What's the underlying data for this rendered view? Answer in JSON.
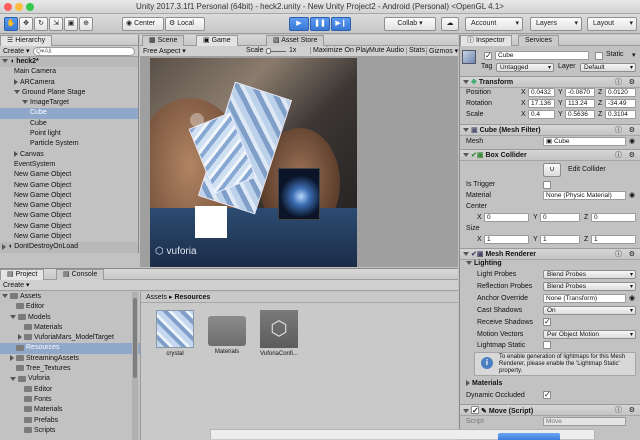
{
  "window": {
    "title": "Unity 2017.3.1f1 Personal (64bit) - heck2.unity - New Unity Project2 - Android (Personal) <OpenGL 4.1>"
  },
  "toolbar": {
    "pivot": "Center",
    "space": "Local",
    "collab": "Collab ▾",
    "account": "Account",
    "layers": "Layers",
    "layout": "Layout"
  },
  "hierarchy": {
    "tab": "Hierarchy",
    "create": "Create",
    "search_placeholder": "Q▾All",
    "scene": "heck2*",
    "items": [
      {
        "label": "Main Camera",
        "indent": 1,
        "fold": "",
        "selected": false
      },
      {
        "label": "ARCamera",
        "indent": 1,
        "fold": "right",
        "selected": false
      },
      {
        "label": "Ground Plane Stage",
        "indent": 1,
        "fold": "down",
        "selected": false
      },
      {
        "label": "ImageTarget",
        "indent": 2,
        "fold": "down",
        "selected": false
      },
      {
        "label": "Cube",
        "indent": 3,
        "fold": "",
        "selected": true
      },
      {
        "label": "Cube",
        "indent": 3,
        "fold": "",
        "selected": false
      },
      {
        "label": "Point light",
        "indent": 3,
        "fold": "",
        "selected": false
      },
      {
        "label": "Particle System",
        "indent": 3,
        "fold": "",
        "selected": false
      },
      {
        "label": "Canvas",
        "indent": 1,
        "fold": "right",
        "selected": false
      },
      {
        "label": "EventSystem",
        "indent": 1,
        "fold": "",
        "selected": false
      },
      {
        "label": "New Game Object",
        "indent": 1,
        "fold": "",
        "selected": false
      },
      {
        "label": "New Game Object",
        "indent": 1,
        "fold": "",
        "selected": false
      },
      {
        "label": "New Game Object",
        "indent": 1,
        "fold": "",
        "selected": false
      },
      {
        "label": "New Game Object",
        "indent": 1,
        "fold": "",
        "selected": false
      },
      {
        "label": "New Game Object",
        "indent": 1,
        "fold": "",
        "selected": false
      },
      {
        "label": "New Game Object",
        "indent": 1,
        "fold": "",
        "selected": false
      },
      {
        "label": "New Game Object",
        "indent": 1,
        "fold": "",
        "selected": false
      }
    ],
    "dontdestroy": "DontDestroyOnLoad"
  },
  "scene_tabs": {
    "scene": "Scene",
    "game": "Game",
    "asset_store": "Asset Store",
    "aspect": "Free Aspect",
    "scale_label": "Scale",
    "scale_value": "1x",
    "maximize": "Maximize On Play",
    "mute": "Mute Audio",
    "stats": "Stats",
    "gizmos": "Gizmos ▾"
  },
  "game_view": {
    "watermark": "vuforia"
  },
  "project": {
    "tab": "Project",
    "console_tab": "Console",
    "create": "Create",
    "breadcrumb_root": "Assets",
    "breadcrumb_sep": "▸",
    "breadcrumb_current": "Resources",
    "tree": [
      {
        "label": "Assets",
        "indent": 0,
        "fold": "down",
        "selected": false
      },
      {
        "label": "Editor",
        "indent": 1,
        "fold": "",
        "selected": false
      },
      {
        "label": "Models",
        "indent": 1,
        "fold": "down",
        "selected": false
      },
      {
        "label": "Materials",
        "indent": 2,
        "fold": "",
        "selected": false
      },
      {
        "label": "VuforiaMars_ModelTarget",
        "indent": 2,
        "fold": "right",
        "selected": false
      },
      {
        "label": "Resources",
        "indent": 1,
        "fold": "",
        "selected": true
      },
      {
        "label": "StreamingAssets",
        "indent": 1,
        "fold": "right",
        "selected": false
      },
      {
        "label": "Tree_Textures",
        "indent": 1,
        "fold": "",
        "selected": false
      },
      {
        "label": "Vuforia",
        "indent": 1,
        "fold": "down",
        "selected": false
      },
      {
        "label": "Editor",
        "indent": 2,
        "fold": "",
        "selected": false
      },
      {
        "label": "Fonts",
        "indent": 2,
        "fold": "",
        "selected": false
      },
      {
        "label": "Materials",
        "indent": 2,
        "fold": "",
        "selected": false
      },
      {
        "label": "Prefabs",
        "indent": 2,
        "fold": "",
        "selected": false
      },
      {
        "label": "Scripts",
        "indent": 2,
        "fold": "",
        "selected": false
      }
    ],
    "assets": [
      {
        "label": "crystal",
        "kind": "crystal"
      },
      {
        "label": "Materials",
        "kind": "folder"
      },
      {
        "label": "VuforiaConfi...",
        "kind": "config"
      }
    ]
  },
  "inspector": {
    "tab": "Inspector",
    "services_tab": "Services",
    "name": "Cube",
    "static_label": "Static",
    "tag_label": "Tag",
    "tag_value": "Untagged",
    "layer_label": "Layer",
    "layer_value": "Default",
    "transform": {
      "title": "Transform",
      "position": {
        "label": "Position",
        "x": "0.0432",
        "y": "-0.0870",
        "z": "0.0120"
      },
      "rotation": {
        "label": "Rotation",
        "x": "17.136",
        "y": "113.24",
        "z": "-34.49"
      },
      "scale": {
        "label": "Scale",
        "x": "0.4",
        "y": "0.5636",
        "z": "0.3104"
      }
    },
    "mesh_filter": {
      "title": "Cube (Mesh Filter)",
      "mesh_label": "Mesh",
      "mesh_value": "Cube"
    },
    "box_collider": {
      "title": "Box Collider",
      "edit_collider": "Edit Collider",
      "is_trigger": "Is Trigger",
      "material_label": "Material",
      "material_value": "None (Physic Material)",
      "center_label": "Center",
      "center": {
        "x": "0",
        "y": "0",
        "z": "0"
      },
      "size_label": "Size",
      "size": {
        "x": "1",
        "y": "1",
        "z": "1"
      }
    },
    "mesh_renderer": {
      "title": "Mesh Renderer",
      "lighting": "Lighting",
      "light_probes": {
        "label": "Light Probes",
        "value": "Blend Probes"
      },
      "reflection_probes": {
        "label": "Reflection Probes",
        "value": "Blend Probes"
      },
      "anchor_override": {
        "label": "Anchor Override",
        "value": "None (Transform)"
      },
      "cast_shadows": {
        "label": "Cast Shadows",
        "value": "On"
      },
      "receive_shadows": "Receive Shadows",
      "motion_vectors": {
        "label": "Motion Vectors",
        "value": "Per Object Motion"
      },
      "lightmap_static": "Lightmap Static",
      "info": "To enable generation of lightmaps for this Mesh Renderer, please enable the 'Lightmap Static' property."
    },
    "materials_section": "Materials",
    "dynamic_occluded": "Dynamic Occluded",
    "move_script": {
      "title": "Move (Script)",
      "script_label": "Script",
      "script_value": "Move"
    }
  },
  "colors": {
    "accent": "#3a78d4",
    "selection": "#8fa7c9",
    "panel": "#c2c2c2"
  }
}
